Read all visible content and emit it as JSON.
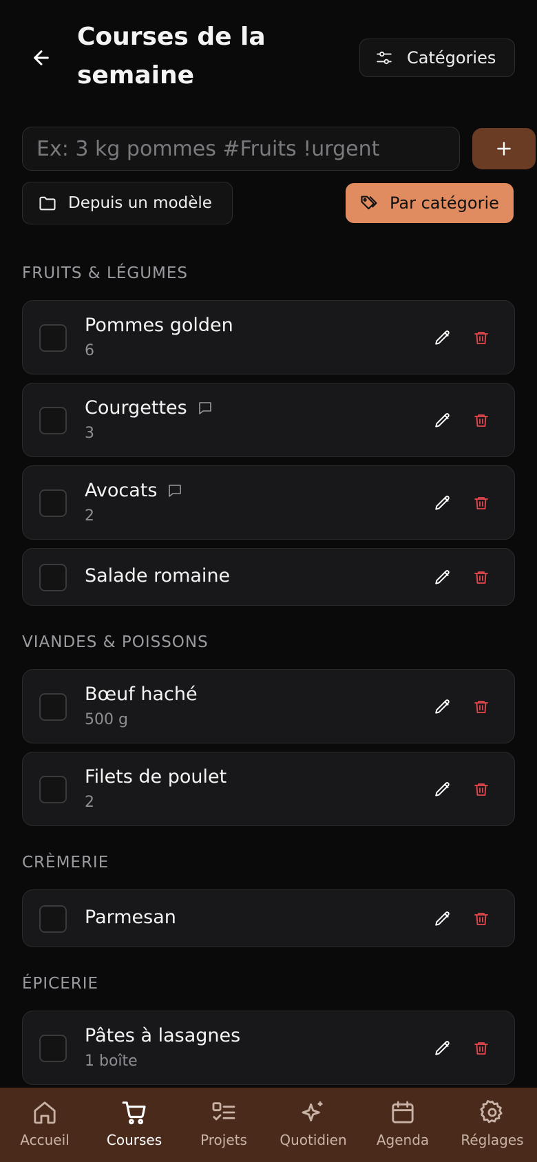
{
  "header": {
    "title": "Courses de la semaine",
    "categories_label": "Catégories"
  },
  "add_bar": {
    "placeholder": "Ex: 3 kg pommes #Fruits !urgent",
    "value": ""
  },
  "actions": {
    "template_label": "Depuis un modèle",
    "by_category_label": "Par catégorie"
  },
  "sections": [
    {
      "title": "FRUITS & LÉGUMES",
      "items": [
        {
          "name": "Pommes golden",
          "qty": "6",
          "note": false
        },
        {
          "name": "Courgettes",
          "qty": "3",
          "note": true
        },
        {
          "name": "Avocats",
          "qty": "2",
          "note": true
        },
        {
          "name": "Salade romaine",
          "qty": "",
          "note": false
        }
      ]
    },
    {
      "title": "VIANDES & POISSONS",
      "items": [
        {
          "name": "Bœuf haché",
          "qty": "500 g",
          "note": false
        },
        {
          "name": "Filets de poulet",
          "qty": "2",
          "note": false
        }
      ]
    },
    {
      "title": "CRÈMERIE",
      "items": [
        {
          "name": "Parmesan",
          "qty": "",
          "note": false
        }
      ]
    },
    {
      "title": "ÉPICERIE",
      "items": [
        {
          "name": "Pâtes à lasagnes",
          "qty": "1 boîte",
          "note": false
        }
      ]
    }
  ],
  "nav": [
    {
      "label": "Accueil",
      "icon": "home-icon",
      "active": false
    },
    {
      "label": "Courses",
      "icon": "cart-icon",
      "active": true
    },
    {
      "label": "Projets",
      "icon": "checklist-icon",
      "active": false
    },
    {
      "label": "Quotidien",
      "icon": "sparkles-icon",
      "active": false
    },
    {
      "label": "Agenda",
      "icon": "calendar-icon",
      "active": false
    },
    {
      "label": "Réglages",
      "icon": "gear-icon",
      "active": false
    }
  ],
  "colors": {
    "background": "#0a0a0a",
    "accent": "#e08c60",
    "add_button": "#6a3c24",
    "nav_background": "#4a2b1b",
    "delete": "#e5484d"
  }
}
